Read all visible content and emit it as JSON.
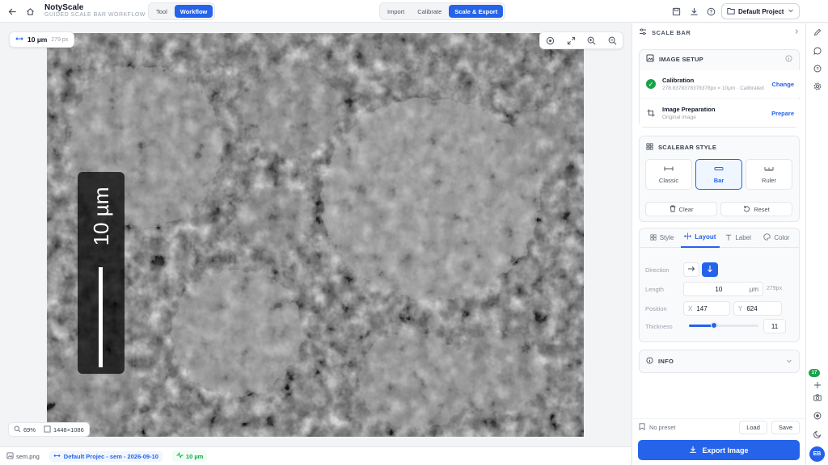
{
  "app": {
    "title": "NotyScale",
    "subtitle": "GUIDED SCALE BAR WORKFLOW"
  },
  "mode_toggle": {
    "options": [
      "Tool",
      "Workflow"
    ],
    "active": "Workflow"
  },
  "steps": {
    "options": [
      "Import",
      "Calibrate",
      "Scale & Export"
    ],
    "active": "Scale & Export"
  },
  "project": {
    "name": "Default Project"
  },
  "canvas": {
    "scale_chip": {
      "value": "10 µm",
      "px": "279 px"
    },
    "scalebar_label": "10 µm",
    "zoom": "69%",
    "dimensions": "1448×1086"
  },
  "statusbar": {
    "file": "sem.png",
    "project_info": "Default Projec - sem - 2026-09-10",
    "scale": "10 µm"
  },
  "panel": {
    "header": "SCALE BAR",
    "image_setup": {
      "title": "IMAGE SETUP",
      "calibration": {
        "label": "Calibration",
        "detail": "278.8378378378378px = 10µm · Calibrated",
        "action": "Change"
      },
      "preparation": {
        "label": "Image Preparation",
        "detail": "Original image",
        "action": "Prepare"
      }
    },
    "scalebar_style": {
      "title": "SCALEBAR STYLE",
      "options": [
        "Classic",
        "Bar",
        "Ruler"
      ],
      "active": "Bar",
      "clear": "Clear",
      "reset": "Reset"
    },
    "tabs": {
      "items": [
        "Style",
        "Layout",
        "Label",
        "Color"
      ],
      "active": "Layout"
    },
    "layout": {
      "direction_label": "Direction",
      "length_label": "Length",
      "length_value": "10",
      "length_unit": "µm",
      "length_px": "279px",
      "position_label": "Position",
      "x_label": "X",
      "x_value": "147",
      "y_label": "Y",
      "y_value": "624",
      "thickness_label": "Thickness",
      "thickness_value": "11",
      "thickness_fraction": 0.36
    },
    "info": {
      "title": "INFO"
    },
    "preset": {
      "label": "No preset",
      "load": "Load",
      "save": "Save"
    },
    "export": "Export Image"
  },
  "rail": {
    "badge": "17",
    "avatar": "EB"
  },
  "colors": {
    "accent": "#2563eb",
    "success": "#16a34a"
  }
}
